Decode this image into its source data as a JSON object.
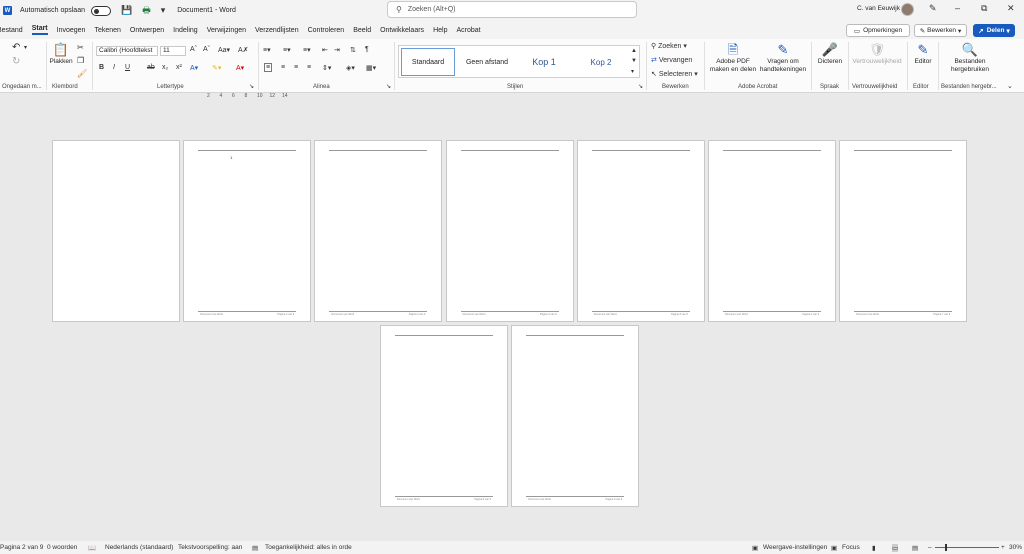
{
  "titlebar": {
    "logo": "W",
    "autosave_label": "Automatisch opslaan",
    "doc_title": "Document1  -  Word",
    "search_placeholder": "Zoeken (Alt+Q)",
    "user_name": "C. van Eeuwijk"
  },
  "menu": {
    "items": [
      "Bestand",
      "Start",
      "Invoegen",
      "Tekenen",
      "Ontwerpen",
      "Indeling",
      "Verwijzingen",
      "Verzendlijsten",
      "Controleren",
      "Beeld",
      "Ontwikkelaars",
      "Help",
      "Acrobat"
    ],
    "active": "Start",
    "comments_label": "Opmerkingen",
    "edit_label": "Bewerken",
    "share_label": "Delen"
  },
  "ribbon": {
    "undo_group": "Ongedaan m...",
    "clipboard": {
      "paste": "Plakken",
      "label": "Klembord"
    },
    "font": {
      "name": "Calibri (Hoofdtekst",
      "size": "11",
      "label": "Lettertype"
    },
    "paragraph": {
      "label": "Alinea"
    },
    "styles": {
      "label": "Stijlen",
      "items": [
        "Standaard",
        "Geen afstand",
        "Kop 1",
        "Kop 2"
      ]
    },
    "editing": {
      "label": "Bewerken",
      "find": "Zoeken",
      "replace": "Vervangen",
      "select": "Selecteren"
    },
    "acrobat": {
      "label": "Adobe Acrobat",
      "pdf": "Adobe PDF maken en delen",
      "sign": "Vragen om handtekeningen"
    },
    "voice": {
      "label": "Spraak",
      "dictate": "Dicteren"
    },
    "sensitivity": {
      "label": "Vertrouwelijkheid",
      "button": "Vertrouwelijkheid"
    },
    "editor": {
      "label": "Editor",
      "button": "Editor"
    },
    "reuse": {
      "label": "Bestanden hergebr...",
      "button": "Bestanden hergebruiken"
    }
  },
  "ruler": [
    "2",
    "4",
    "6",
    "8",
    "10",
    "12",
    "14"
  ],
  "vruler": [
    "1",
    "2",
    "3",
    "4",
    "5",
    "6",
    "7",
    "8",
    "9",
    "10",
    "11",
    "12",
    "13",
    "14"
  ],
  "pages": [
    {
      "has_header": false,
      "footer_left": "",
      "footer_right": ""
    },
    {
      "has_header": true,
      "cursor": "1",
      "footer_left": "Document van Word",
      "footer_right": "Pagina 2 van 9"
    },
    {
      "has_header": true,
      "footer_left": "Document van Word",
      "footer_right": "Pagina 3 van 9"
    },
    {
      "has_header": true,
      "footer_left": "Document van Word",
      "footer_right": "Pagina 4 van 9"
    },
    {
      "has_header": true,
      "footer_left": "Document van Word",
      "footer_right": "Pagina 5 van 9"
    },
    {
      "has_header": true,
      "footer_left": "Document van Word",
      "footer_right": "Pagina 6 van 9"
    },
    {
      "has_header": true,
      "footer_left": "Document van Word",
      "footer_right": "Pagina 7 van 9"
    },
    {
      "has_header": true,
      "footer_left": "Document van Word",
      "footer_right": "Pagina 8 van 9"
    },
    {
      "has_header": true,
      "footer_left": "Document van Word",
      "footer_right": "Pagina 9 van 9"
    }
  ],
  "status": {
    "page": "Pagina 2 van 9",
    "words": "0 woorden",
    "language": "Nederlands (standaard)",
    "proofing": "Tekstvoorspelling: aan",
    "accessibility": "Toegankelijkheid: alles in orde",
    "display": "Weergave-instellingen",
    "focus": "Focus",
    "zoom": "30%"
  },
  "colors": {
    "accent": "#185abd",
    "canvas": "#e9e9e9",
    "chrome": "#f3f3f3"
  }
}
